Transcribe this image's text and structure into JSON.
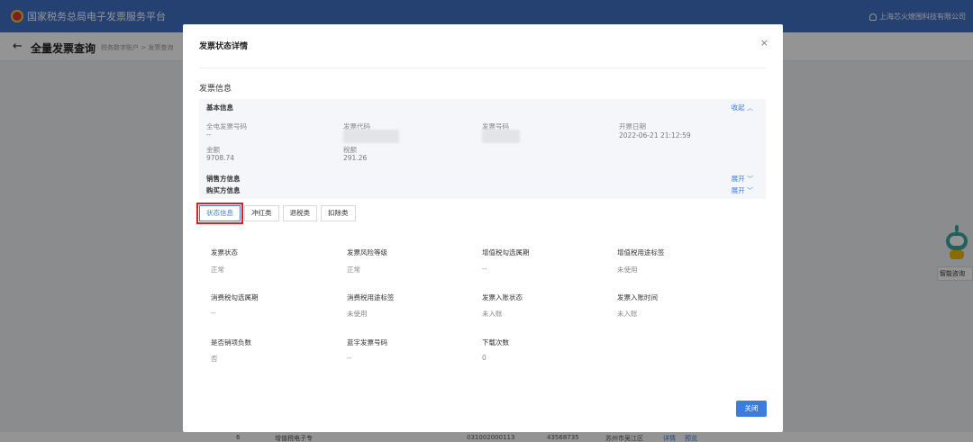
{
  "app": {
    "title": "国家税务总局电子发票服务平台",
    "company": "上海芯火燎围科技有限公司",
    "page_title": "全量发票查询",
    "breadcrumb": "税务数字账户 > 发票查询"
  },
  "background_row": {
    "index": "6",
    "type": "增值税电子专",
    "code": "031002000113",
    "number": "43568735",
    "place": "苏州市吴江区",
    "detail": "详情",
    "preview": "预览"
  },
  "assistant": {
    "label": "智能咨询"
  },
  "modal": {
    "title": "发票状态详情",
    "section_title": "发票信息",
    "basic_info": {
      "header": "基本信息",
      "collapse": "收起",
      "fields": [
        {
          "label": "全电发票号码",
          "value": "--"
        },
        {
          "label": "发票代码",
          "value": ""
        },
        {
          "label": "发票号码",
          "value": ""
        },
        {
          "label": "开票日期",
          "value": "2022-06-21 21:12:59"
        },
        {
          "label": "金额",
          "value": "9708.74"
        },
        {
          "label": "税额",
          "value": "291.26"
        }
      ]
    },
    "seller": {
      "label": "销售方信息",
      "expand": "展开"
    },
    "buyer": {
      "label": "购买方信息",
      "expand": "展开"
    },
    "tabs": [
      "状态信息",
      "冲红类",
      "退税类",
      "扣除类"
    ],
    "status_rows": [
      [
        {
          "label": "发票状态",
          "value": "正常"
        },
        {
          "label": "发票风险等级",
          "value": "正常"
        },
        {
          "label": "增值税勾选属期",
          "value": "--"
        },
        {
          "label": "增值税用途标签",
          "value": "未使用"
        }
      ],
      [
        {
          "label": "消费税勾选属期",
          "value": "--"
        },
        {
          "label": "消费税用途标签",
          "value": "未使用"
        },
        {
          "label": "发票入账状态",
          "value": "未入账"
        },
        {
          "label": "发票入账时间",
          "value": "未入账"
        }
      ],
      [
        {
          "label": "是否销项负数",
          "value": "否"
        },
        {
          "label": "蓝字发票号码",
          "value": "--"
        },
        {
          "label": "下载次数",
          "value": "0"
        }
      ]
    ],
    "close_button": "关闭"
  }
}
